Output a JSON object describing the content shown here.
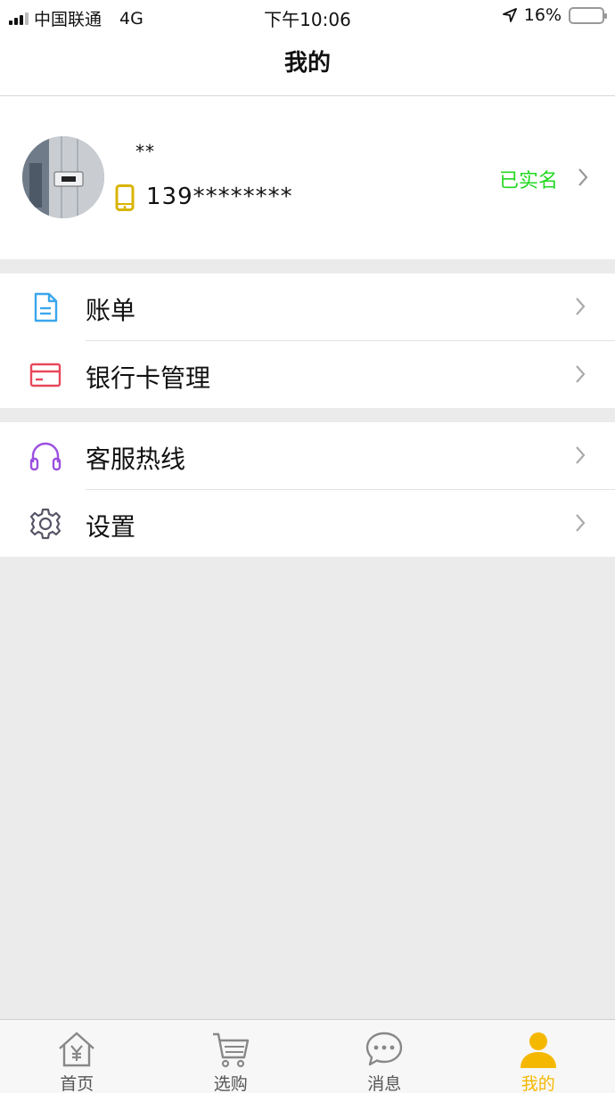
{
  "status_bar": {
    "carrier": "中国联通",
    "network": "4G",
    "time": "下午10:06",
    "battery_percent": "16%",
    "battery_level": 0.16
  },
  "nav": {
    "title": "我的"
  },
  "profile": {
    "name": "**",
    "phone": "139********",
    "verified_label": "已实名"
  },
  "menu": {
    "group1": [
      {
        "label": "账单",
        "icon": "bill-document-icon"
      },
      {
        "label": "银行卡管理",
        "icon": "bank-card-icon"
      }
    ],
    "group2": [
      {
        "label": "客服热线",
        "icon": "headset-icon"
      },
      {
        "label": "设置",
        "icon": "gear-icon"
      }
    ]
  },
  "tab_bar": {
    "tabs": [
      {
        "label": "首页",
        "icon": "home-yen-icon"
      },
      {
        "label": "选购",
        "icon": "shopping-cart-icon"
      },
      {
        "label": "消息",
        "icon": "chat-bubble-icon"
      },
      {
        "label": "我的",
        "icon": "user-icon",
        "active": true
      }
    ]
  },
  "colors": {
    "accent": "#f5b800",
    "verified": "#22d820",
    "bill_icon": "#3aa6ec",
    "card_icon": "#e8485a",
    "headset_icon": "#9b4fe0",
    "gear_icon": "#555566"
  }
}
